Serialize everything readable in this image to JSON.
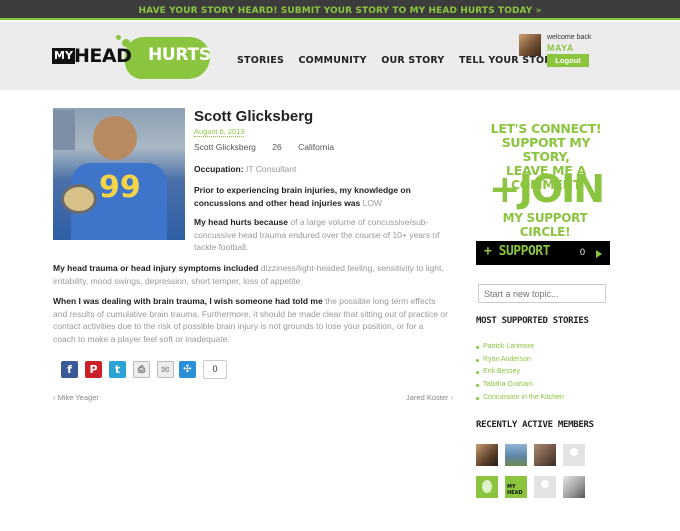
{
  "banner": {
    "text": "HAVE YOUR STORY HEARD!  SUBMIT YOUR STORY TO MY HEAD HURTS TODAY »"
  },
  "logo": {
    "my": "MY",
    "head": "HEAD",
    "hurts": "HURTS"
  },
  "nav": [
    {
      "label": "STORIES"
    },
    {
      "label": "COMMUNITY"
    },
    {
      "label": "OUR STORY"
    },
    {
      "label": "TELL YOUR STORY"
    }
  ],
  "user": {
    "welcome": "welcome back",
    "name": "MAYA",
    "logout": "Logout"
  },
  "story": {
    "name": "Scott Glicksberg",
    "date": "August 6, 2013",
    "meta": {
      "name": "Scott Glicksberg",
      "age": "26",
      "location": "California"
    },
    "occupation": {
      "label": "Occupation:",
      "value": "IT Consultant"
    },
    "prior": {
      "label": "Prior to experiencing brain injuries, my knowledge on concussions and other head injuries was",
      "value": "LOW"
    },
    "because": {
      "label": "My head hurts because",
      "value": "of a large volume of concussive/sub-concussive head trauma endured over the course of 10+ years of tackle football."
    },
    "symptoms": {
      "label": "My head trauma or head injury symptoms included",
      "value": "dizziness/light-headed feeling, sensitivity to light, irritability, mood swings, depression, short temper, loss of appetite."
    },
    "wish": {
      "label": "When I was dealing with brain trauma, I wish someone had told me",
      "value": "the possible long term effects and results of cumulative brain trauma. Furthermore, it should be made clear that sitting out of practice or contact activities due to the risk of possible brain injury is not grounds to lose your position, or for a coach to make a player feel soft or inadequate."
    }
  },
  "share": {
    "count": "0",
    "icons": [
      "facebook-icon",
      "pinterest-icon",
      "twitter-icon",
      "print-icon",
      "email-icon",
      "share-icon"
    ]
  },
  "pager": {
    "prev": "‹ Mike Yeager",
    "next": "Jared Koster ›"
  },
  "sidebar": {
    "connect": [
      "LET'S CONNECT!",
      "SUPPORT MY STORY,",
      "LEAVE ME A COMMENT"
    ],
    "join": "+JOIN",
    "circle": "MY SUPPORT CIRCLE!",
    "support": {
      "label": "+ SUPPORT",
      "count": "0"
    },
    "topic_placeholder": "Start a new topic...",
    "most_supported": "MOST SUPPORTED STORIES",
    "stories": [
      "Patrick Larimore",
      "Ryan Anderson",
      "Erik Bessey",
      "Tabitha Graham",
      "Concussion in the Kitchen"
    ],
    "recent_members": "RECENTLY ACTIVE MEMBERS"
  },
  "colors": {
    "accent": "#8bc53f",
    "dark": "#3c3c3c",
    "header_bg": "#ececec"
  }
}
